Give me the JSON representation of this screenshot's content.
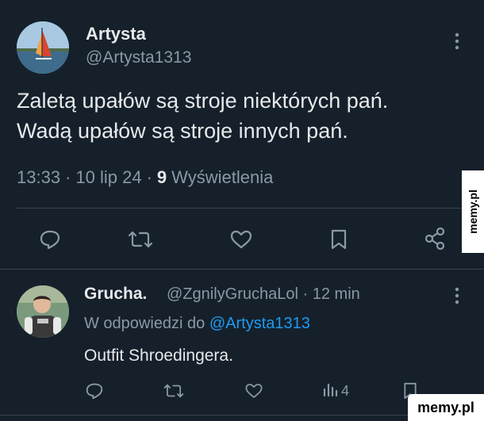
{
  "tweet": {
    "author_name": "Artysta",
    "author_handle": "@Artysta1313",
    "text_line1": "Zaletą upałów są stroje niektórych pań.",
    "text_line2": "Wadą upałów są stroje innych pań.",
    "time": "13:33",
    "sep1": "·",
    "date": "10 lip 24",
    "sep2": "·",
    "views_count": "9",
    "views_label": "Wyświetlenia",
    "actions": [
      "reply-icon",
      "retweet-icon",
      "like-icon",
      "bookmark-icon",
      "share-icon"
    ]
  },
  "reply": {
    "author_name": "Grucha.",
    "author_handle": "@ZgnilyGruchaLol",
    "sep": "·",
    "time_ago": "12 min",
    "reply_to_label": "W odpowiedzi do",
    "reply_to_handle": "@Artysta1313",
    "text": "Outfit Shroedingera.",
    "views_count": "4",
    "actions": [
      "reply-icon",
      "retweet-icon",
      "like-icon",
      "views-icon",
      "bookmark-icon"
    ]
  },
  "watermarks": {
    "side": "memy.pl",
    "corner": "memy.pl"
  },
  "colors": {
    "background": "#15202b",
    "text_primary": "#e7e9ea",
    "text_secondary": "#8b98a5",
    "link": "#1d9bf0",
    "divider": "#38444d"
  }
}
